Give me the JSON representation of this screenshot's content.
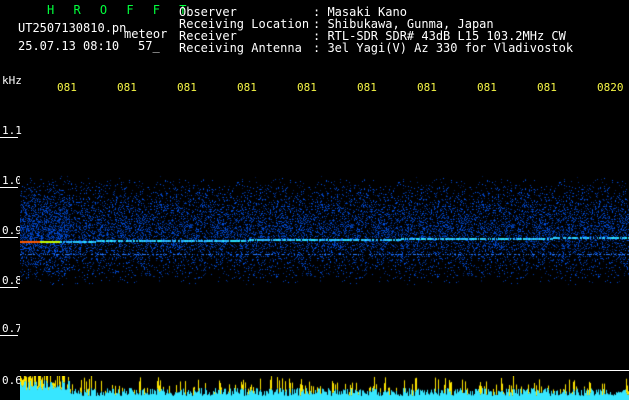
{
  "header": {
    "app_name": "H R O F F T",
    "filename": "UT2507130810.pn",
    "mode": "meteor",
    "date_time": "25.07.13 08:10",
    "count": "57_",
    "fields": [
      {
        "label": "Observer",
        "value": ": Masaki Kano"
      },
      {
        "label": "Receiving Location",
        "value": ": Shibukawa, Gunma, Japan"
      },
      {
        "label": "Receiver",
        "value": ": RTL-SDR SDR# 43dB L15 103.2MHz CW"
      },
      {
        "label": "Receiving Antenna",
        "value": ": 3el Yagi(V) Az 330 for Vladivostok"
      }
    ]
  },
  "axis": {
    "unit": "kHz",
    "y_labels": [
      "1.1",
      "1.0",
      "0.9",
      "0.8",
      "0.7",
      "0.6"
    ],
    "x_labels": [
      "081",
      "081",
      "081",
      "081",
      "081",
      "081",
      "081",
      "081",
      "081",
      "0820"
    ]
  },
  "colors": {
    "background": "#000000",
    "header_green": "#00ff3c",
    "tick_yellow": "#f5f545",
    "signal_cyan": "#37e6ff",
    "noise_blue": "#1a3cff"
  }
}
